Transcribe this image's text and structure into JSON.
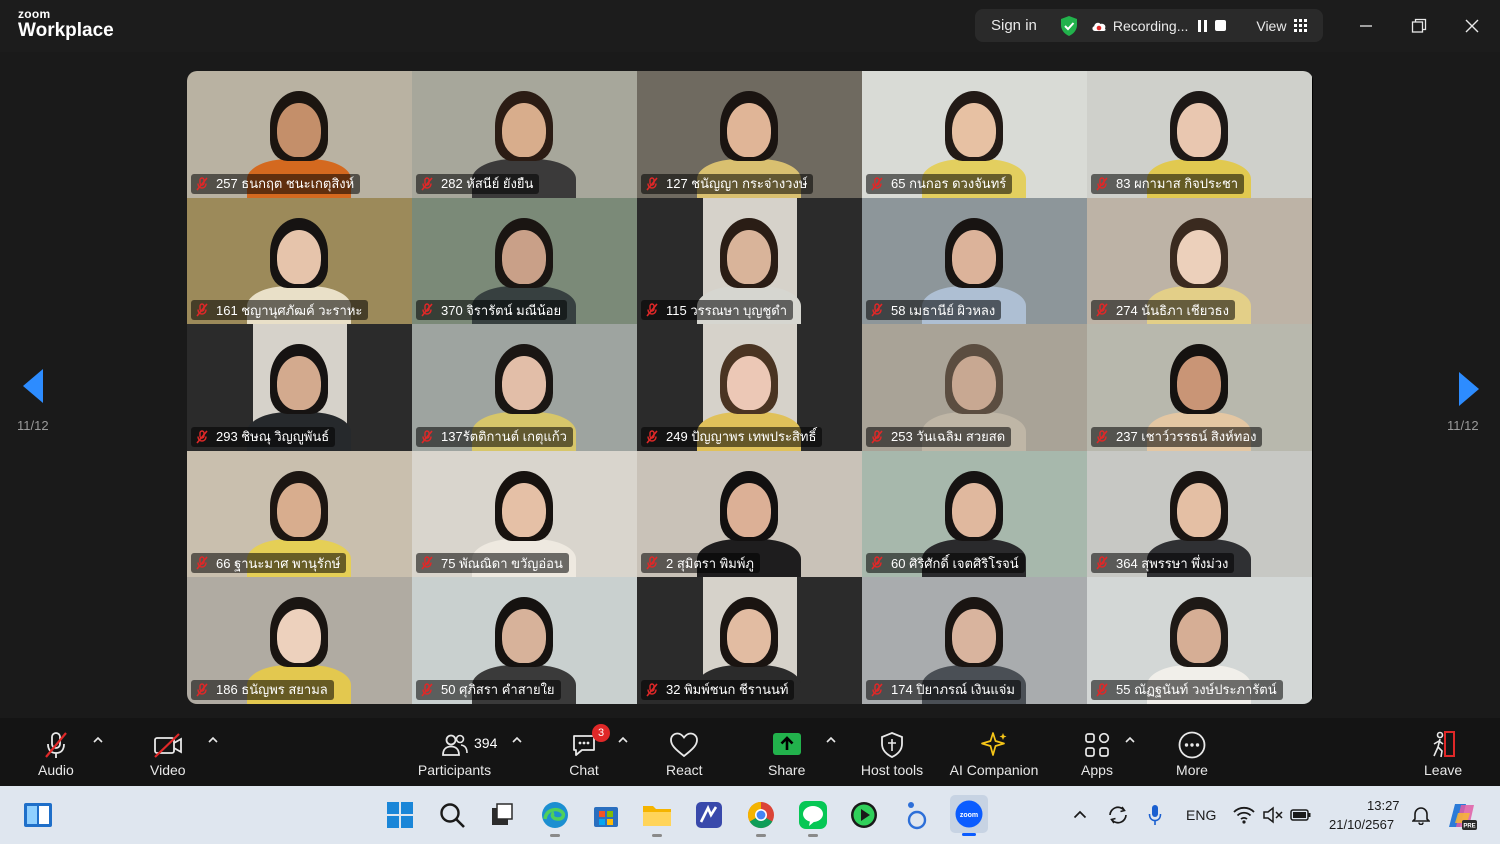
{
  "app": {
    "brand_small": "zoom",
    "brand_large": "Workplace"
  },
  "topbar": {
    "sign_in": "Sign in",
    "recording": "Recording...",
    "view": "View"
  },
  "navigation": {
    "left_page": "11/12",
    "right_page": "11/12"
  },
  "participants": [
    {
      "label": "257 ธนกฤต ชนะเกตุสิงห์",
      "bg": "#b9b2a2",
      "skin": "#c48f6a",
      "hair": "#1b1510",
      "shirt": "#d4691f"
    },
    {
      "label": "282 หัสนีย์ ยังยืน",
      "bg": "#a7a79b",
      "skin": "#d8ad8c",
      "hair": "#2b1c14",
      "shirt": "#3b3a3a"
    },
    {
      "label": "127 ชนัญญา กระจ่างวงษ์",
      "bg": "#6f6a60",
      "skin": "#e0b597",
      "hair": "#1a1411",
      "shirt": "#d9c070"
    },
    {
      "label": "65 กนกอร ดวงจันทร์",
      "bg": "#d9dbd6",
      "skin": "#e7c1a3",
      "hair": "#221a16",
      "shirt": "#e3cf5f"
    },
    {
      "label": "83 ผกามาส กิจประชา",
      "bg": "#cfd0cb",
      "skin": "#e9c7b0",
      "hair": "#1d1816",
      "shirt": "#e1c950"
    },
    {
      "label": "161 ชญานุศภัฒค์ วะราหะ",
      "bg": "#9c8a5a",
      "skin": "#e6c4ab",
      "hair": "#161312",
      "shirt": "#e9e0c8"
    },
    {
      "label": "370 จิรารัตน์ มณีน้อย",
      "bg": "#7b8a78",
      "skin": "#c9a088",
      "hair": "#1a1512",
      "shirt": "#374040"
    },
    {
      "label": "115 วรรณษา บุญชูดำ",
      "bg": "#2b2b2b",
      "skin": "#d9b49a",
      "hair": "#2a1d15",
      "shirt": "#d6d6d0"
    },
    {
      "label": "58 เมธานีย์ ผิวหลง",
      "bg": "#8d969a",
      "skin": "#dcb39a",
      "hair": "#181412",
      "shirt": "#aebfd3"
    },
    {
      "label": "274 นันธิภา เชียวธง",
      "bg": "#bdb3a6",
      "skin": "#ecd0bb",
      "hair": "#3a2a1f",
      "shirt": "#e3cf88"
    },
    {
      "label": "293 ชิษณุ วิญญูพันธ์",
      "bg": "#2b2b2b",
      "skin": "#d3aa8e",
      "hair": "#161312",
      "shirt": "#26292c"
    },
    {
      "label": "137รัตติกานต์ เกตุแก้ว",
      "bg": "#9ea4a0",
      "skin": "#e2bea8",
      "hair": "#1a1613",
      "shirt": "#d7c66a"
    },
    {
      "label": "249 ปัญญาพร เทพประสิทธิ์",
      "bg": "#2b2b2b",
      "skin": "#ecc8b6",
      "hair": "#4a3422",
      "shirt": "#e0c15a"
    },
    {
      "label": "253 วันเฉลิม สวยสด",
      "bg": "#a9a397",
      "skin": "#c8a892",
      "hair": "#5b4d40",
      "shirt": "#bfb6a6"
    },
    {
      "label": "237 เชาว์วรรธน์ สิงห์ทอง",
      "bg": "#b8b8ad",
      "skin": "#c99576",
      "hair": "#151210",
      "shirt": "#e4c7a3"
    },
    {
      "label": "66 ฐานะมาศ พานุรักษ์",
      "bg": "#c9bfae",
      "skin": "#d8ad8e",
      "hair": "#1d1612",
      "shirt": "#e5cf56"
    },
    {
      "label": "75 พัณณิดา ขวัญอ่อน",
      "bg": "#d9d5cd",
      "skin": "#e5c0a6",
      "hair": "#17120f",
      "shirt": "#eee9e0"
    },
    {
      "label": "2 สุมิตรา พิมพ์ภู",
      "bg": "#c9c2b8",
      "skin": "#dcb096",
      "hair": "#121010",
      "shirt": "#1e1d1e"
    },
    {
      "label": "60 ศิริศักดิ์ เจตศิริโรจน์",
      "bg": "#a7b8ac",
      "skin": "#e0b89e",
      "hair": "#161312",
      "shirt": "#2a2a2c"
    },
    {
      "label": "364 สุพรรษา พึ่งม่วง",
      "bg": "#c7c8c4",
      "skin": "#e4bfa4",
      "hair": "#1a1512",
      "shirt": "#2f3033"
    },
    {
      "label": "186 ธนัญพร สยามล",
      "bg": "#b0aba2",
      "skin": "#edd1bd",
      "hair": "#1a1512",
      "shirt": "#e3c84f"
    },
    {
      "label": "50 ศุภิสรา คำสายใย",
      "bg": "#c9d0cf",
      "skin": "#d7b29a",
      "hair": "#151210",
      "shirt": "#3a3a3a"
    },
    {
      "label": "32 พิมพ์ชนก ชีรานนท์",
      "bg": "#2b2b2b",
      "skin": "#e2bca2",
      "hair": "#1a1411",
      "shirt": "#2b2b2b"
    },
    {
      "label": "174 ปิยาภรณ์ เงินแจ่ม",
      "bg": "#a9acae",
      "skin": "#d9b49e",
      "hair": "#1a1512",
      "shirt": "#4a4f55"
    },
    {
      "label": "55 ณัฏฐนันท์ วงษ์ประภารัตน์",
      "bg": "#d3d7d6",
      "skin": "#d6ae95",
      "hair": "#1e1916",
      "shirt": "#f1efea"
    }
  ],
  "toolbar": {
    "audio": "Audio",
    "video": "Video",
    "participants": "Participants",
    "participants_count": "394",
    "chat": "Chat",
    "chat_badge": "3",
    "react": "React",
    "share": "Share",
    "host_tools": "Host tools",
    "ai_companion": "AI Companion",
    "apps": "Apps",
    "more": "More",
    "leave": "Leave"
  },
  "taskbar": {
    "language": "ENG",
    "time": "13:27",
    "date": "21/10/2567"
  },
  "colors": {
    "accent_blue": "#2d8cff",
    "share_green": "#22b24c",
    "mute_red": "#e02828",
    "ai_yellow": "#f5c518"
  }
}
